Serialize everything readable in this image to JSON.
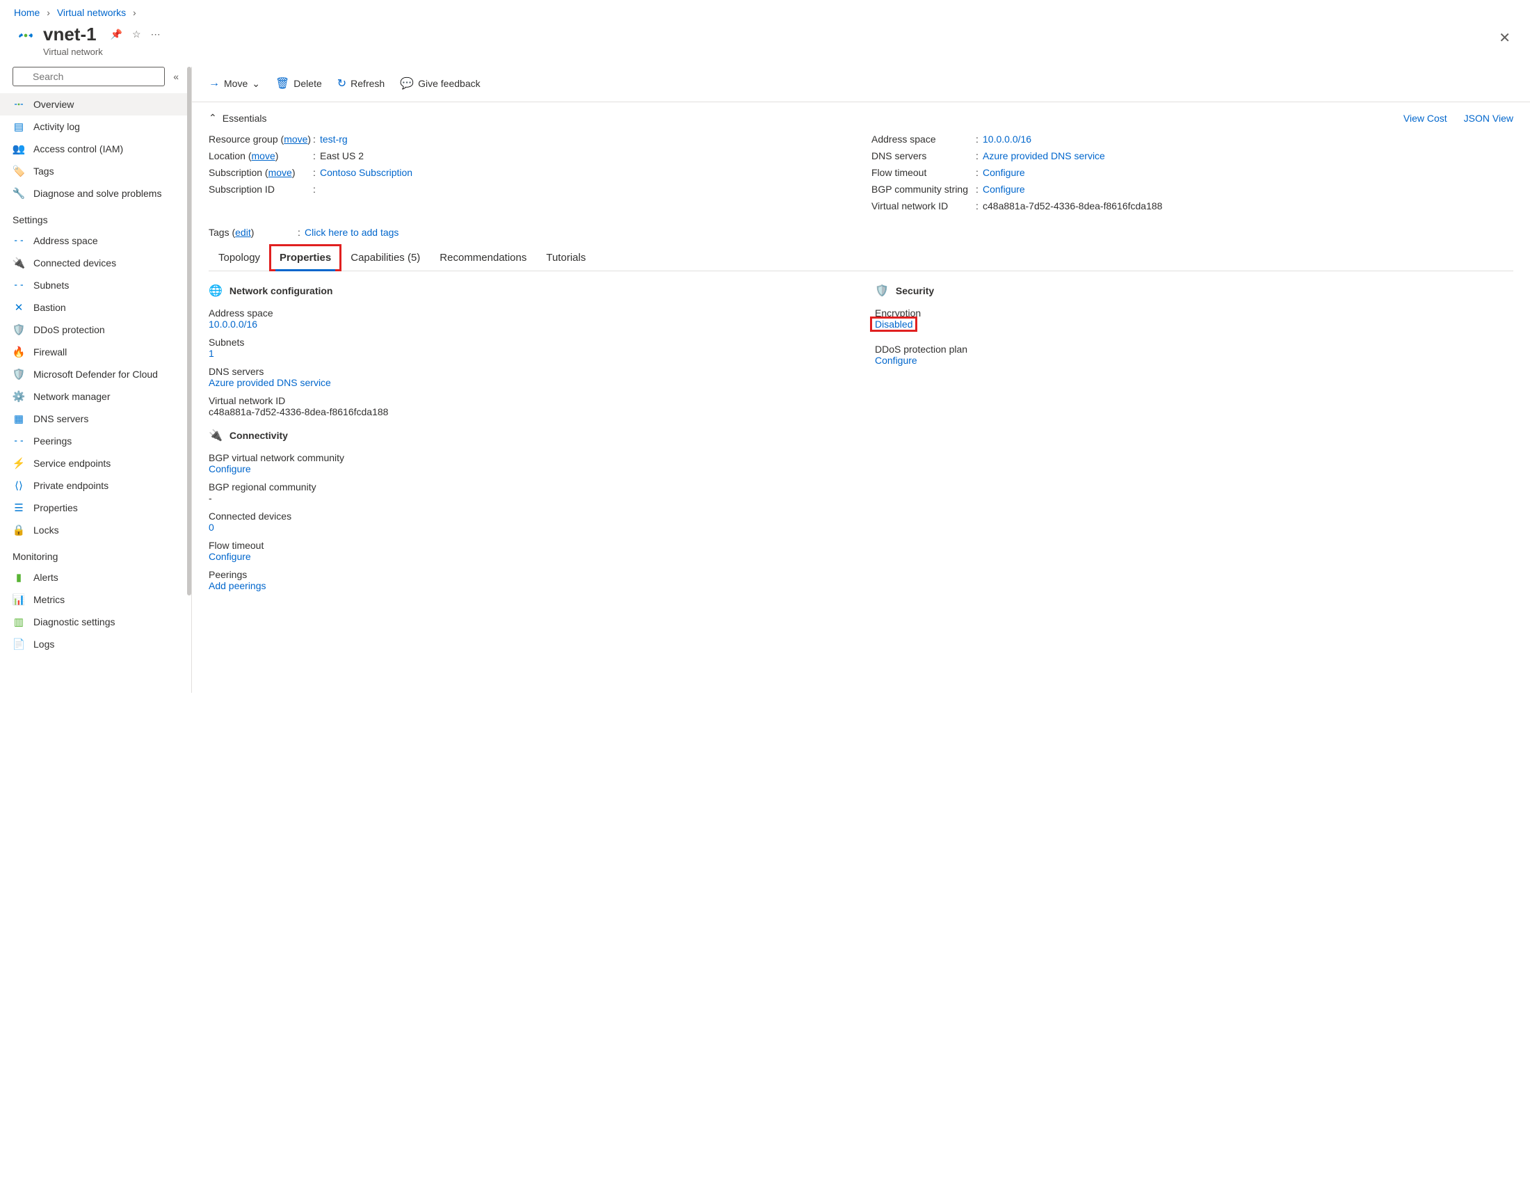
{
  "breadcrumb": {
    "home": "Home",
    "vnets": "Virtual networks"
  },
  "header": {
    "title": "vnet-1",
    "subtitle": "Virtual network"
  },
  "search": {
    "placeholder": "Search"
  },
  "nav": {
    "overview": "Overview",
    "activity": "Activity log",
    "iam": "Access control (IAM)",
    "tags": "Tags",
    "diagnose": "Diagnose and solve problems",
    "settings_section": "Settings",
    "address_space": "Address space",
    "connected_devices": "Connected devices",
    "subnets": "Subnets",
    "bastion": "Bastion",
    "ddos": "DDoS protection",
    "firewall": "Firewall",
    "defender": "Microsoft Defender for Cloud",
    "netmgr": "Network manager",
    "dnsservers": "DNS servers",
    "peerings": "Peerings",
    "svcendpoints": "Service endpoints",
    "privendpoints": "Private endpoints",
    "properties": "Properties",
    "locks": "Locks",
    "monitoring_section": "Monitoring",
    "alerts": "Alerts",
    "metrics": "Metrics",
    "diagsettings": "Diagnostic settings",
    "logs": "Logs"
  },
  "toolbar": {
    "move": "Move",
    "delete": "Delete",
    "refresh": "Refresh",
    "feedback": "Give feedback"
  },
  "essentials": {
    "title": "Essentials",
    "viewcost": "View Cost",
    "jsonview": "JSON View",
    "move": "move",
    "rg_label": "Resource group",
    "rg_value": "test-rg",
    "loc_label": "Location",
    "loc_value": "East US 2",
    "sub_label": "Subscription",
    "sub_value": "Contoso Subscription",
    "subid_label": "Subscription ID",
    "subid_value": "",
    "addr_label": "Address space",
    "addr_value": "10.0.0.0/16",
    "dns_label": "DNS servers",
    "dns_value": "Azure provided DNS service",
    "flow_label": "Flow timeout",
    "flow_value": "Configure",
    "bgp_label": "BGP community string",
    "bgp_value": "Configure",
    "vnetid_label": "Virtual network ID",
    "vnetid_value": "c48a881a-7d52-4336-8dea-f8616fcda188",
    "tags_label": "Tags",
    "tags_edit": "edit",
    "tags_value": "Click here to add tags"
  },
  "tabs": {
    "topology": "Topology",
    "properties": "Properties",
    "capabilities": "Capabilities (5)",
    "recommendations": "Recommendations",
    "tutorials": "Tutorials"
  },
  "props": {
    "netconfig": "Network configuration",
    "addr_label": "Address space",
    "addr_value": "10.0.0.0/16",
    "subnets_label": "Subnets",
    "subnets_value": "1",
    "dns_label": "DNS servers",
    "dns_value": "Azure provided DNS service",
    "vnetid_label": "Virtual network ID",
    "vnetid_value": "c48a881a-7d52-4336-8dea-f8616fcda188",
    "connectivity": "Connectivity",
    "bgpvnet_label": "BGP virtual network community",
    "bgpvnet_value": "Configure",
    "bgpreg_label": "BGP regional community",
    "bgpreg_value": "-",
    "conndev_label": "Connected devices",
    "conndev_value": "0",
    "flow_label": "Flow timeout",
    "flow_value": "Configure",
    "peer_label": "Peerings",
    "peer_value": "Add peerings",
    "security": "Security",
    "enc_label": "Encryption",
    "enc_value": "Disabled",
    "ddos_label": "DDoS protection plan",
    "ddos_value": "Configure"
  }
}
